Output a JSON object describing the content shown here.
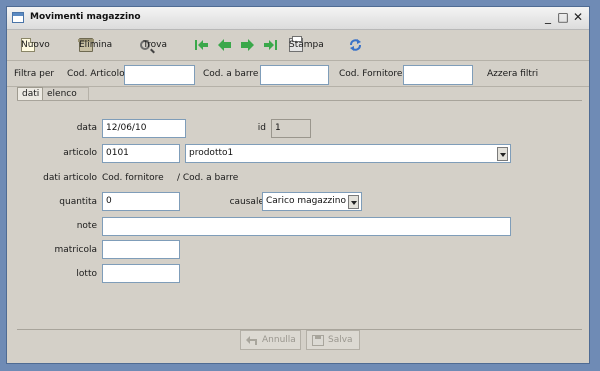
{
  "window": {
    "title": "Movimenti magazzino",
    "controls": [
      "minimize",
      "maximize",
      "close"
    ]
  },
  "toolbar": {
    "new_label": "Nuovo",
    "delete_label": "Elimina",
    "find_label": "Trova",
    "print_label": "Stampa",
    "nav_icons": [
      "first-record-icon",
      "previous-record-icon",
      "next-record-icon",
      "last-record-icon"
    ],
    "refresh_icon": "refresh-icon",
    "nav_color": "#3aa84a"
  },
  "filter": {
    "prefix": "Filtra per",
    "cod_articolo_label": "Cod. Articolo",
    "cod_articolo_value": "",
    "cod_barre_label": "Cod. a barre",
    "cod_barre_value": "",
    "cod_fornitore_label": "Cod. Fornitore",
    "cod_fornitore_value": "",
    "reset_label": "Azzera filtri"
  },
  "tabs": [
    {
      "label": "dati",
      "active": true
    },
    {
      "label": "elenco",
      "active": false
    }
  ],
  "form": {
    "data_label": "data",
    "data_value": "12/06/10",
    "id_label": "id",
    "id_value": "1",
    "articolo_label": "articolo",
    "articolo_code": "0101",
    "articolo_name": "prodotto1",
    "dati_articolo_label": "dati articolo",
    "dati_articolo_value": "Cod. fornitore",
    "dati_articolo_sep": "/ Cod. a barre",
    "quantita_label": "quantita",
    "quantita_value": "0",
    "causale_label": "causale",
    "causale_value": "Carico magazzino",
    "note_label": "note",
    "note_value": "",
    "matricola_label": "matricola",
    "matricola_value": "",
    "lotto_label": "lotto",
    "lotto_value": ""
  },
  "actions": {
    "cancel_label": "Annulla",
    "save_label": "Salva"
  }
}
